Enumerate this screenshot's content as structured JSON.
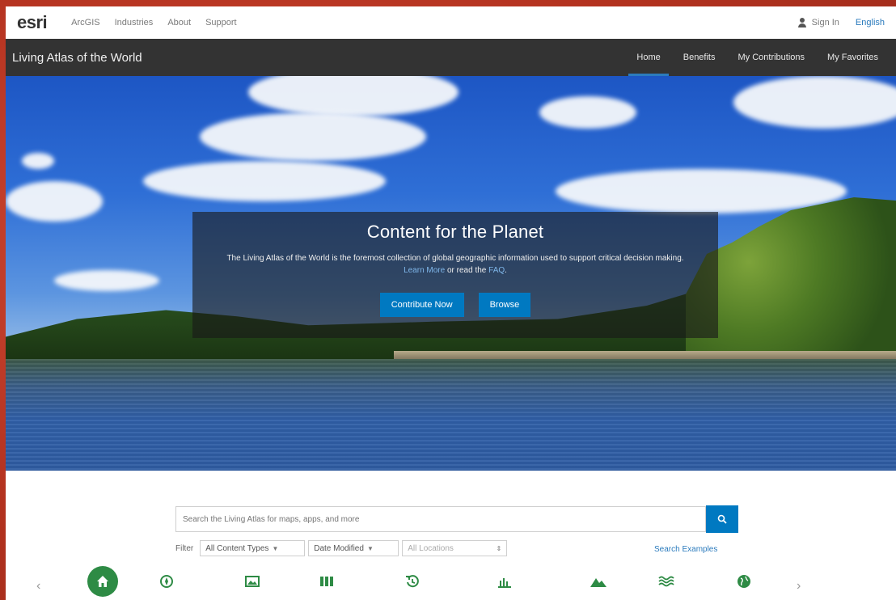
{
  "esri_bar": {
    "logo": "esri",
    "links": [
      "ArcGIS",
      "Industries",
      "About",
      "Support"
    ],
    "sign_in": "Sign In",
    "language": "English"
  },
  "atlas_nav": {
    "title": "Living Atlas of the World",
    "tabs": [
      "Home",
      "Benefits",
      "My Contributions",
      "My Favorites"
    ],
    "active_tab": "Home"
  },
  "hero": {
    "title": "Content for the Planet",
    "desc_part1": "The Living Atlas of the World is the foremost collection of global geographic information used to support critical decision making.",
    "learn_more": "Learn More",
    "desc_part2": "or read the",
    "faq": "FAQ",
    "contribute_label": "Contribute Now",
    "browse_label": "Browse"
  },
  "search": {
    "placeholder": "Search the Living Atlas for maps, apps, and more",
    "filter_label": "Filter",
    "content_types": "All Content Types",
    "date_modified": "Date Modified",
    "locations": "All Locations",
    "examples": "Search Examples"
  },
  "categories": [
    "home",
    "basemap",
    "imagery",
    "maps",
    "history",
    "chart",
    "landscape",
    "ocean",
    "world"
  ],
  "colors": {
    "accent": "#0079c1",
    "nav_bg": "#333333",
    "home_green": "#2e8b45",
    "icon_green": "#2e8b45",
    "frame_red": "#c0392b"
  }
}
